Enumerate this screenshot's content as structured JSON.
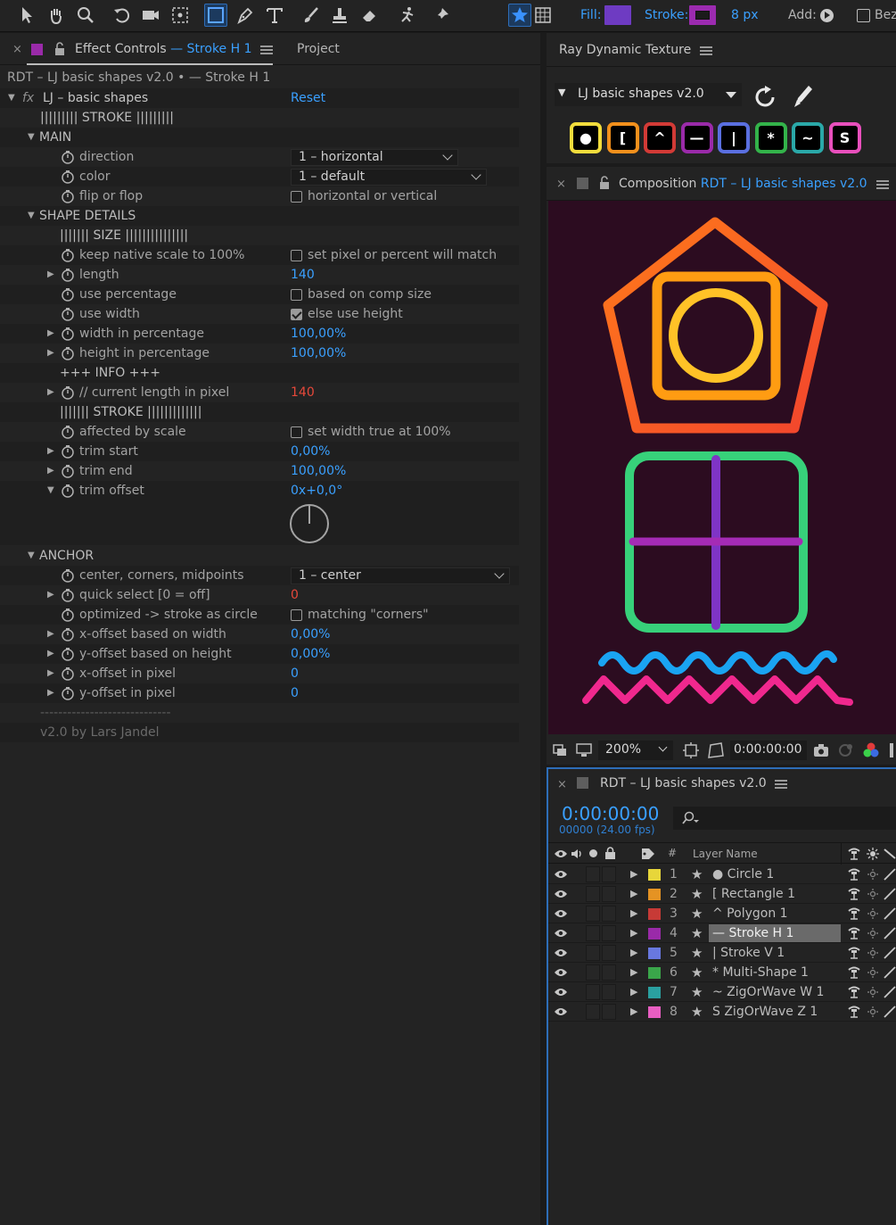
{
  "toolbar": {
    "fill_label": "Fill:",
    "fill_color": "#6e3bc2",
    "stroke_label": "Stroke:",
    "stroke_color": "#9c2bb0",
    "stroke_width": "8 px",
    "add_label": "Add:",
    "bez_label": "Bez"
  },
  "effect_controls": {
    "tab_prefix": "Effect Controls",
    "tab_layer": "— Stroke H 1",
    "project_tab": "Project",
    "breadcrumb": "RDT – LJ basic shapes v2.0 • — Stroke H 1",
    "effect_name": "LJ – basic shapes",
    "fx_label": "fx",
    "reset": "Reset",
    "stroke_header": "||||||||| STROKE |||||||||",
    "main_group": "MAIN",
    "direction_label": "direction",
    "direction_value": "1 – horizontal",
    "color_label": "color",
    "color_value": "1 – default",
    "flip_label": "flip or flop",
    "flip_option": "horizontal or vertical",
    "shape_details_group": "SHAPE DETAILS",
    "size_header": "||||||| SIZE |||||||||||||||",
    "keep_native_label": "keep native scale to 100%",
    "keep_native_option": "set pixel or percent will match",
    "length_label": "length",
    "length_value": "140",
    "use_percentage_label": "use percentage",
    "use_percentage_option": "based on comp size",
    "use_width_label": "use width",
    "use_width_option": "else use height",
    "width_pct_label": "width in percentage",
    "width_pct_value": "100,00%",
    "height_pct_label": "height in percentage",
    "height_pct_value": "100,00%",
    "info_header": "+++ INFO +++",
    "current_length_label": "// current length in pixel",
    "current_length_value": "140",
    "stroke_sub_header": "||||||| STROKE |||||||||||||",
    "affected_label": "affected by scale",
    "affected_option": "set width true at 100%",
    "trim_start_label": "trim start",
    "trim_start_value": "0,00%",
    "trim_end_label": "trim end",
    "trim_end_value": "100,00%",
    "trim_offset_label": "trim offset",
    "trim_offset_value": "0x+0,0°",
    "anchor_group": "ANCHOR",
    "center_label": "center, corners, midpoints",
    "center_value": "1 – center",
    "quick_select_label": "quick select [0 = off]",
    "quick_select_value": "0",
    "optimized_label": "optimized -> stroke as circle",
    "optimized_option": "matching \"corners\"",
    "x_off_w_label": "x-offset based on width",
    "x_off_w_value": "0,00%",
    "y_off_h_label": "y-offset based on height",
    "y_off_h_value": "0,00%",
    "x_off_px_label": "x-offset in pixel",
    "x_off_px_value": "0",
    "y_off_px_label": "y-offset in pixel",
    "y_off_px_value": "0",
    "divider": "-----------------------------",
    "credit": "v2.0 by Lars Jandel"
  },
  "ray_panel": {
    "title": "Ray Dynamic Texture",
    "preset": "LJ basic shapes v2.0",
    "buttons": [
      {
        "label": "●",
        "color": "#f2dd3c"
      },
      {
        "label": "[",
        "color": "#f2901c"
      },
      {
        "label": "^",
        "color": "#d23a36"
      },
      {
        "label": "—",
        "color": "#9a2aa9"
      },
      {
        "label": "|",
        "color": "#5a6fe0"
      },
      {
        "label": "*",
        "color": "#33b34a"
      },
      {
        "label": "~",
        "color": "#2aa8a8"
      },
      {
        "label": "S",
        "color": "#e84fbc"
      }
    ]
  },
  "composition": {
    "title_prefix": "Composition",
    "title_comp": "RDT – LJ basic shapes v2.0",
    "zoom": "200%",
    "timecode": "0:00:00:00"
  },
  "timeline": {
    "comp_name": "RDT – LJ basic shapes v2.0",
    "timecode": "0:00:00:00",
    "frame_info": "00000 (24.00 fps)",
    "col_num": "#",
    "col_layer_name": "Layer Name",
    "layers": [
      {
        "num": "1",
        "name": "● Circle 1",
        "color": "#e7d63a"
      },
      {
        "num": "2",
        "name": "[ Rectangle 1",
        "color": "#e59323"
      },
      {
        "num": "3",
        "name": "^ Polygon 1",
        "color": "#c73a36"
      },
      {
        "num": "4",
        "name": "— Stroke H 1",
        "color": "#9a2aa9"
      },
      {
        "num": "5",
        "name": "| Stroke V 1",
        "color": "#6878e0"
      },
      {
        "num": "6",
        "name": "* Multi-Shape 1",
        "color": "#3aa64a"
      },
      {
        "num": "7",
        "name": "~ ZigOrWave W 1",
        "color": "#2aa0a0"
      },
      {
        "num": "8",
        "name": "S ZigOrWave Z 1",
        "color": "#e85ec2"
      }
    ]
  }
}
